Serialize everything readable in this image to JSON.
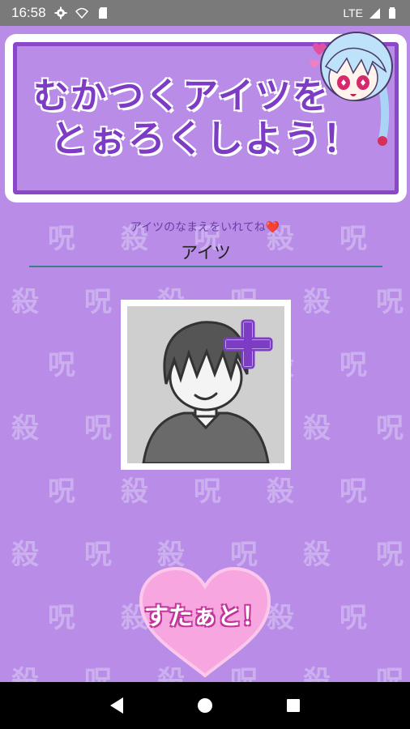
{
  "status_bar": {
    "time": "16:58",
    "network": "LTE",
    "icons": [
      "gear-icon",
      "wifi-icon",
      "sd-card-icon",
      "signal-icon",
      "battery-icon"
    ]
  },
  "background": {
    "color": "#b98ce8",
    "pattern_chars": [
      "殺",
      "呪"
    ]
  },
  "title": {
    "line1": "むかつくアイツを",
    "line2": "とぉろくしよう！",
    "text_color": "#7c3cc4",
    "frame_color": "#8a47c7"
  },
  "name_field": {
    "label": "アイツのなまえをいれてね❤️",
    "value": "アイツ"
  },
  "photo": {
    "add_icon": "plus-icon"
  },
  "start_button": {
    "label": "すたぁと！",
    "color": "#f7a6df"
  },
  "nav_bar": {
    "icons": [
      "back-icon",
      "home-icon",
      "recents-icon"
    ]
  }
}
